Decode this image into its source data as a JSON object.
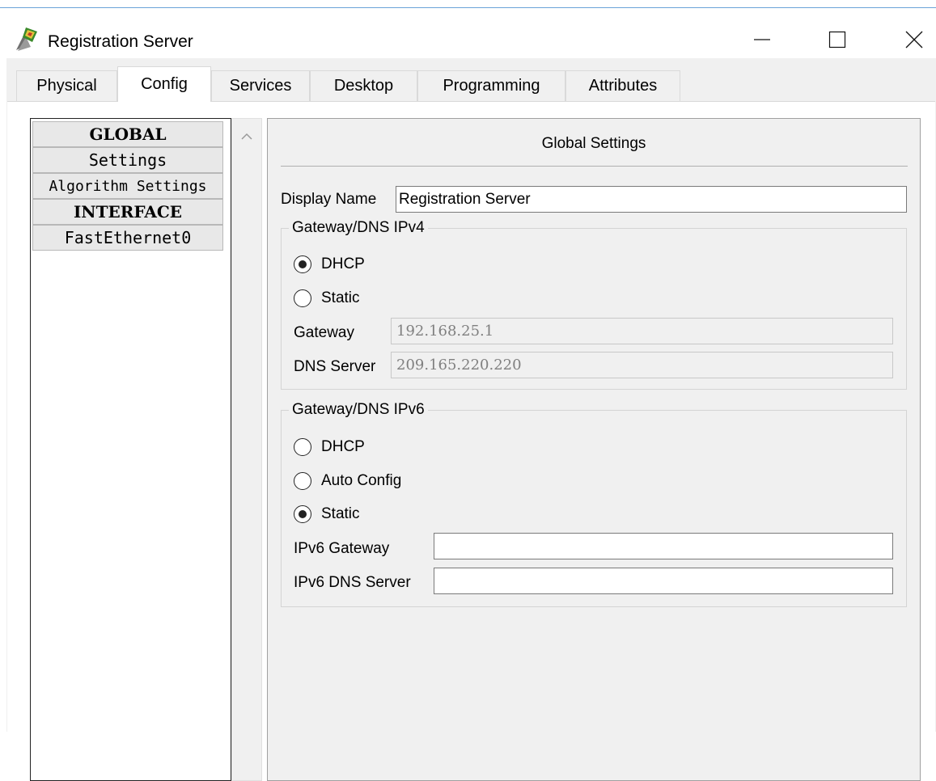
{
  "window": {
    "title": "Registration Server",
    "icon": "device-server-icon",
    "controls": {
      "minimize": "minimize-icon",
      "maximize": "maximize-icon",
      "close": "close-icon"
    }
  },
  "tabs": [
    {
      "label": "Physical",
      "active": false
    },
    {
      "label": "Config",
      "active": true
    },
    {
      "label": "Services",
      "active": false
    },
    {
      "label": "Desktop",
      "active": false
    },
    {
      "label": "Programming",
      "active": false
    },
    {
      "label": "Attributes",
      "active": false
    }
  ],
  "sidebar": {
    "items": [
      {
        "label": "GLOBAL",
        "type": "header"
      },
      {
        "label": "Settings",
        "type": "item"
      },
      {
        "label": "Algorithm Settings",
        "type": "item"
      },
      {
        "label": "INTERFACE",
        "type": "header"
      },
      {
        "label": "FastEthernet0",
        "type": "item"
      }
    ]
  },
  "settings": {
    "title": "Global Settings",
    "display_name": {
      "label": "Display Name",
      "value": "Registration Server"
    },
    "ipv4": {
      "group_title": "Gateway/DNS IPv4",
      "options": [
        {
          "label": "DHCP",
          "checked": true
        },
        {
          "label": "Static",
          "checked": false
        }
      ],
      "gateway": {
        "label": "Gateway",
        "value": "192.168.25.1"
      },
      "dns": {
        "label": "DNS Server",
        "value": "209.165.220.220"
      }
    },
    "ipv6": {
      "group_title": "Gateway/DNS IPv6",
      "options": [
        {
          "label": "DHCP",
          "checked": false
        },
        {
          "label": "Auto Config",
          "checked": false
        },
        {
          "label": "Static",
          "checked": true
        }
      ],
      "gateway": {
        "label": "IPv6 Gateway",
        "value": ""
      },
      "dns": {
        "label": "IPv6 DNS Server",
        "value": ""
      }
    }
  },
  "colors": {
    "window_bg": "#f0f0f0",
    "pane_bg": "#ffffff",
    "border": "#a0a0a0",
    "disabled_text": "#808080"
  }
}
